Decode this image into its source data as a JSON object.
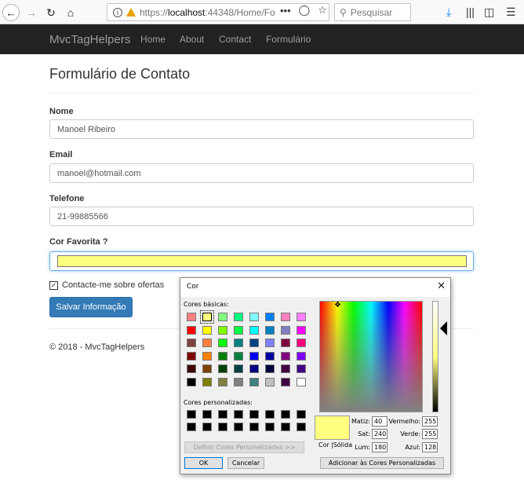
{
  "browser": {
    "url_proto": "https://",
    "url_host": "localhost",
    "url_path": ":44348/Home/Fo",
    "search_placeholder": "Pesquisar",
    "icons": [
      "back-icon",
      "forward-icon",
      "reload-icon",
      "home-icon",
      "info-icon",
      "warning-icon",
      "more-icon",
      "pocket-icon",
      "star-icon",
      "search-icon",
      "download-icon",
      "library-icon",
      "sidebar-icon",
      "menu-icon"
    ]
  },
  "navbar": {
    "brand": "MvcTagHelpers",
    "links": [
      "Home",
      "About",
      "Contact",
      "Formulário"
    ]
  },
  "form": {
    "title": "Formulário de Contato",
    "name_label": "Nome",
    "name_value": "Manoel Ribeiro",
    "email_label": "Email",
    "email_value": "manoel@hotmail.com",
    "phone_label": "Telefone",
    "phone_value": "21-99885566",
    "color_label": "Cor Favorita ?",
    "color_value": "#ffff80",
    "offers_label": "Contacte-me sobre ofertas",
    "offers_checked": true,
    "submit_label": "Salvar Informação"
  },
  "footer": {
    "text": "© 2018 - MvcTagHelpers"
  },
  "color_dialog": {
    "title": "Cor",
    "basic_colors_label": "Cores básicas:",
    "basic_colors": [
      [
        "#ff8080",
        "#ffff80",
        "#80ff80",
        "#00ff80",
        "#80ffff",
        "#0080ff",
        "#ff80c0",
        "#ff80ff"
      ],
      [
        "#ff0000",
        "#ffff00",
        "#80ff00",
        "#00ff40",
        "#00ffff",
        "#0080c0",
        "#8080c0",
        "#ff00ff"
      ],
      [
        "#804040",
        "#ff8040",
        "#00ff00",
        "#008080",
        "#004080",
        "#8080ff",
        "#800040",
        "#ff0080"
      ],
      [
        "#800000",
        "#ff8000",
        "#008000",
        "#008040",
        "#0000ff",
        "#0000a0",
        "#800080",
        "#8000ff"
      ],
      [
        "#400000",
        "#804000",
        "#004000",
        "#004040",
        "#000080",
        "#000040",
        "#400040",
        "#400080"
      ],
      [
        "#000000",
        "#808000",
        "#808040",
        "#808080",
        "#408080",
        "#c0c0c0",
        "#400040",
        "#ffffff"
      ]
    ],
    "selected_basic": [
      0,
      1
    ],
    "custom_colors_label": "Cores personalizadas:",
    "define_custom_label": "Definir Cores Personalizadas >>",
    "ok_label": "OK",
    "cancel_label": "Cancelar",
    "preview_color_label": "Cor",
    "preview_solid_label": "|Sólida",
    "hue_label": "Matiz:",
    "hue_value": "40",
    "sat_label": "Sat:",
    "sat_value": "240",
    "lum_label": "Lum:",
    "lum_value": "180",
    "red_label": "Vermelho:",
    "red_value": "255",
    "green_label": "Verde:",
    "green_value": "255",
    "blue_label": "Azul:",
    "blue_value": "128",
    "add_custom_label": "Adicionar às Cores Personalizadas",
    "current_color": "#ffff80"
  }
}
